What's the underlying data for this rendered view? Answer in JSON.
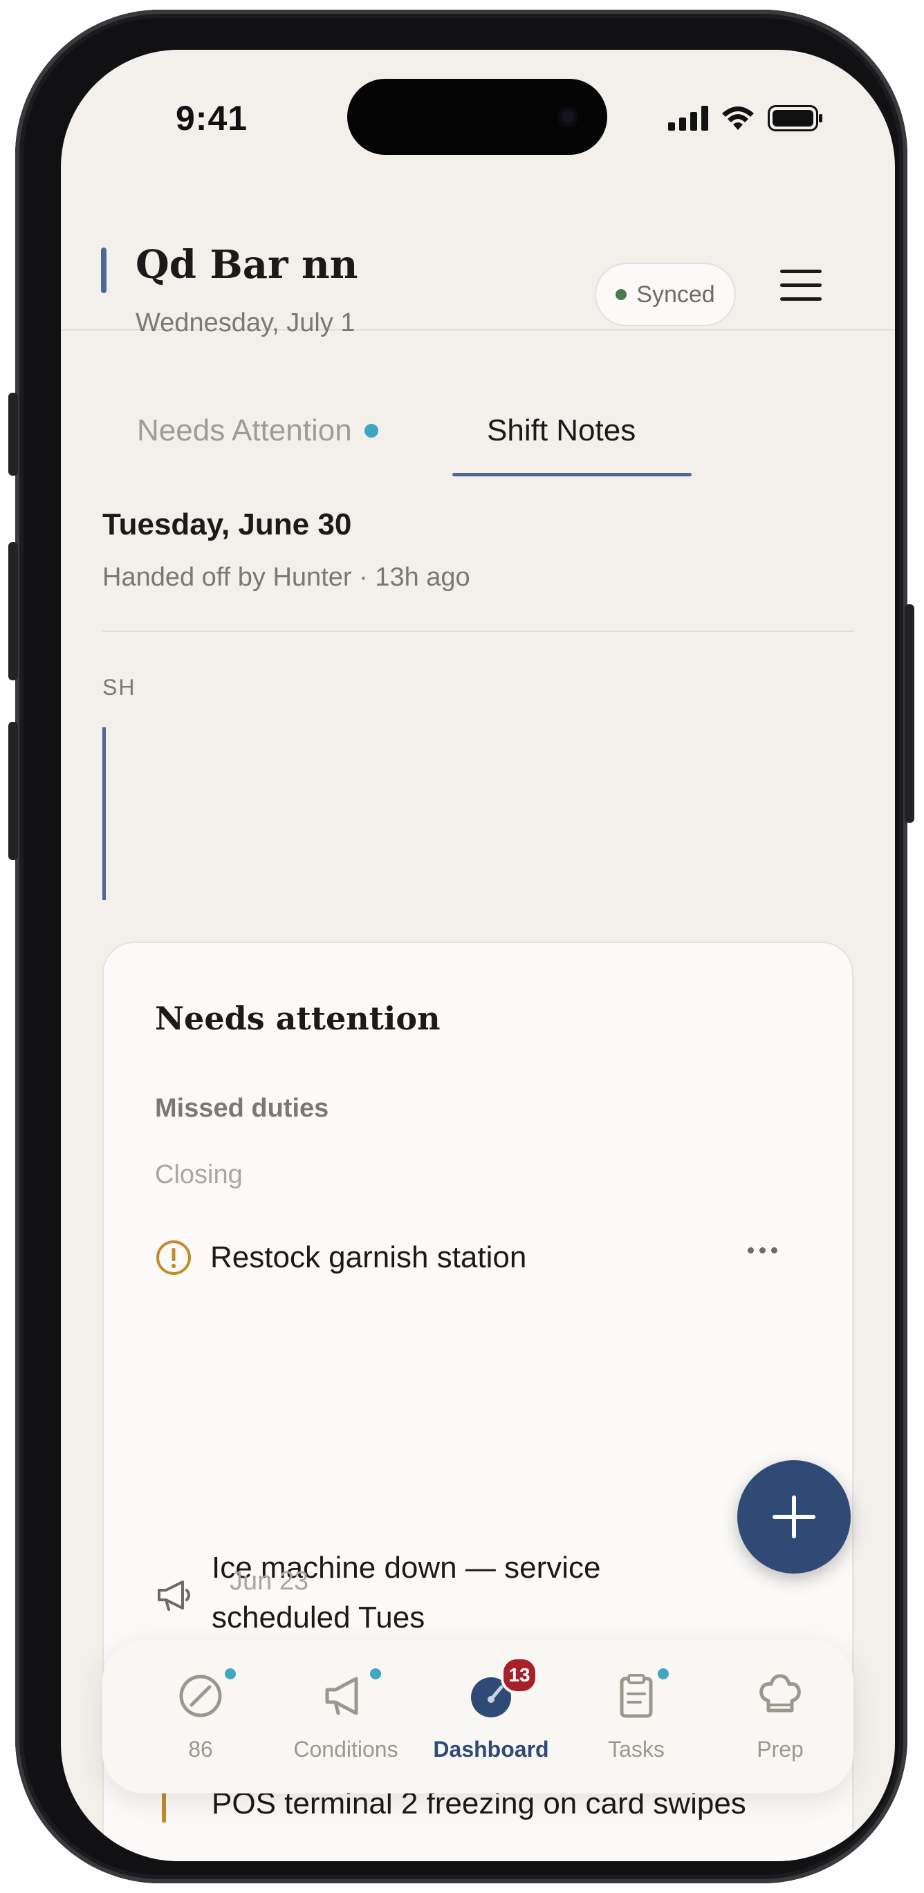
{
  "status_bar": {
    "time": "9:41"
  },
  "header": {
    "venue": "Qd Bar nn",
    "date": "Wednesday, July 1",
    "sync_status": "Synced"
  },
  "tabs": [
    {
      "label": "Needs Attention",
      "active": false,
      "has_dot": true
    },
    {
      "label": "Shift Notes",
      "active": true
    }
  ],
  "shift_notes": {
    "date": "Tuesday, June 30",
    "handoff": "Handed off by Hunter · 13h ago",
    "section_label": "SH"
  },
  "needs_attention_card": {
    "title": "Needs attention",
    "subtitle": "Missed duties",
    "group": "Closing",
    "duty": "Restock garnish station",
    "notes": [
      {
        "text": "Ice machine down — service scheduled Tues",
        "date": "Jun 23",
        "icon": "megaphone-icon"
      },
      {
        "text": "POS terminal 2 freezing on card swipes",
        "icon": "flag-icon"
      }
    ]
  },
  "bottom_nav": [
    {
      "label": "86",
      "icon": "eighty-six-icon",
      "dot": true
    },
    {
      "label": "Conditions",
      "icon": "megaphone-icon",
      "dot": true
    },
    {
      "label": "Dashboard",
      "icon": "gauge-icon",
      "badge": "13",
      "active": true
    },
    {
      "label": "Tasks",
      "icon": "clipboard-icon",
      "dot": true
    },
    {
      "label": "Prep",
      "icon": "chef-hat-icon"
    }
  ],
  "colors": {
    "background": "#f3f0eb",
    "accent": "#4e6794",
    "primary_dark": "#2f4a75",
    "badge": "#a8202a",
    "teal_dot": "#3fa7c2",
    "warning": "#c48a2c",
    "synced_dot": "#4c7a4e"
  }
}
